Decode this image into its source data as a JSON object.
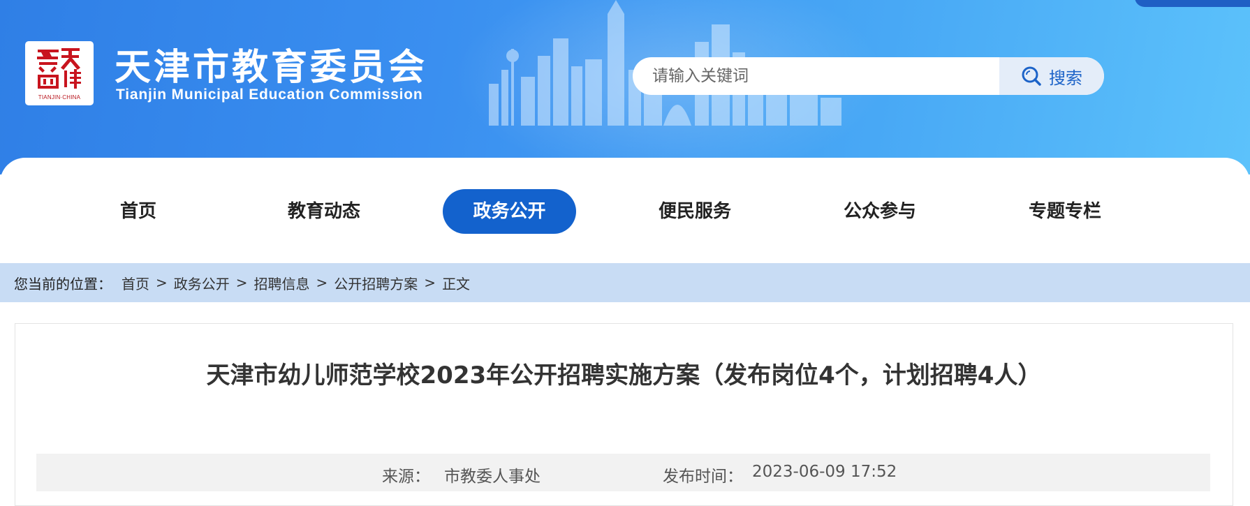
{
  "header": {
    "site_title_cn": "天津市教育委员会",
    "site_title_en": "Tianjin Municipal Education Commission",
    "logo_seal_text": "TIANJIN·CHINA",
    "search": {
      "placeholder": "请输入关键词",
      "button_label": "搜索"
    }
  },
  "nav": {
    "items": [
      {
        "label": "首页"
      },
      {
        "label": "教育动态"
      },
      {
        "label": "政务公开",
        "active": true
      },
      {
        "label": "便民服务"
      },
      {
        "label": "公众参与"
      },
      {
        "label": "专题专栏"
      }
    ]
  },
  "breadcrumb": {
    "prefix": "您当前的位置：",
    "items": [
      "首页",
      "政务公开",
      "招聘信息",
      "公开招聘方案"
    ],
    "current": "正文",
    "separator": ">"
  },
  "article": {
    "title": "天津市幼儿师范学校2023年公开招聘实施方案（发布岗位4个，计划招聘4人）",
    "source_label": "来源：",
    "source_value": "市教委人事处",
    "date_label": "发布时间：",
    "date_value": "2023-06-09 17:52"
  },
  "colors": {
    "header_blue": "#2f7fe6",
    "nav_active": "#1362cd",
    "breadcrumb_bg": "#c8dcf4",
    "seal_red": "#b8141c"
  }
}
